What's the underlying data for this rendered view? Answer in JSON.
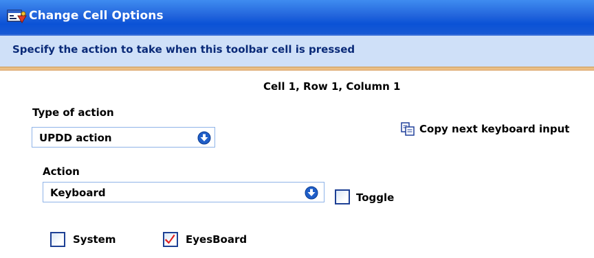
{
  "window": {
    "title": "Change Cell Options",
    "title_icon": "dialog-settings-icon"
  },
  "header": {
    "subtitle": "Specify the action to take when this toolbar cell is pressed"
  },
  "cell": {
    "location": "Cell 1, Row 1, Column 1"
  },
  "type_of_action": {
    "label": "Type of action",
    "value": "UPDD action",
    "arrow_icon": "chevron-down-circle-icon"
  },
  "copy_keyboard": {
    "label": "Copy next keyboard input",
    "icon": "copy-icon"
  },
  "action": {
    "label": "Action",
    "value": "Keyboard",
    "arrow_icon": "chevron-down-circle-icon"
  },
  "toggle": {
    "label": "Toggle",
    "checked": false
  },
  "system": {
    "label": "System",
    "checked": false
  },
  "eyesboard": {
    "label": "EyesBoard",
    "checked": true
  },
  "colors": {
    "titlebar": "#0a52d6",
    "subtitle_bg": "#cfe0f8",
    "subtitle_text": "#0a2a78",
    "accent_rule": "#f0c68c",
    "checkmark": "#e02020"
  }
}
